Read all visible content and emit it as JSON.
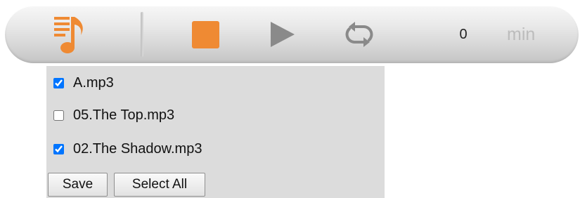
{
  "player": {
    "time_value": "0",
    "time_unit": "min",
    "accent_color": "#ef8a33",
    "icons": [
      "playlist-icon",
      "stop-icon",
      "play-icon",
      "repeat-icon"
    ]
  },
  "playlist": {
    "tracks": [
      {
        "label": "A.mp3",
        "checked": true
      },
      {
        "label": "05.The Top.mp3",
        "checked": false
      },
      {
        "label": "02.The Shadow.mp3",
        "checked": true
      }
    ],
    "save_label": "Save",
    "select_all_label": "Select All"
  }
}
